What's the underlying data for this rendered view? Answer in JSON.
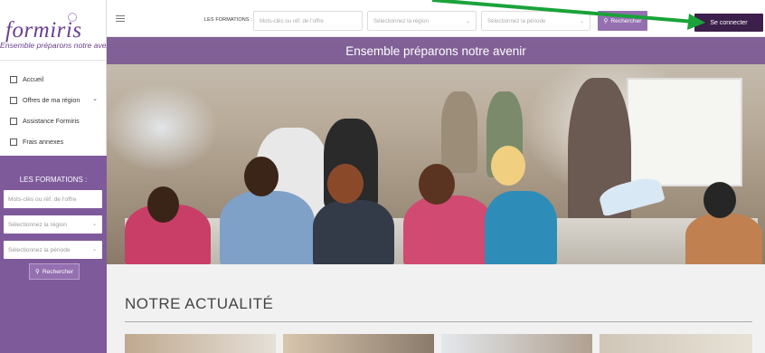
{
  "sidebar": {
    "logo": "formiris",
    "tagline": "Ensemble préparons notre avenir",
    "nav": [
      {
        "label": "Accueil"
      },
      {
        "label": "Offres de ma région",
        "has_dropdown": true
      },
      {
        "label": "Assistance Formiris"
      },
      {
        "label": "Frais annexes"
      }
    ],
    "panel": {
      "title": "LES FORMATIONS :",
      "keyword_placeholder": "Mots-clés ou réf. de l'offre",
      "region_placeholder": "Sélectionnez la région",
      "period_placeholder": "Sélectionnez la période",
      "search_label": "Rechercher"
    }
  },
  "topbar": {
    "label": "LES FORMATIONS :",
    "keyword_placeholder": "Mots-clés ou réf. de l'offre",
    "region_placeholder": "Sélectionnez la région",
    "period_placeholder": "Sélectionnez la période",
    "search_label": "Rechercher",
    "connect_label": "Se connecter"
  },
  "hero": {
    "title": "Ensemble préparons notre avenir"
  },
  "news": {
    "title": "NOTRE ACTUALITÉ"
  },
  "colors": {
    "brand_purple": "#7e5a9b",
    "button_purple": "#9470b1",
    "dark_button": "#3c1f4a",
    "annotation_arrow": "#1aa33a"
  },
  "icons": {
    "menu": "hamburger-icon",
    "search": "search-icon",
    "nav_box": "square-icon",
    "dropdown": "chevron-down-icon"
  }
}
